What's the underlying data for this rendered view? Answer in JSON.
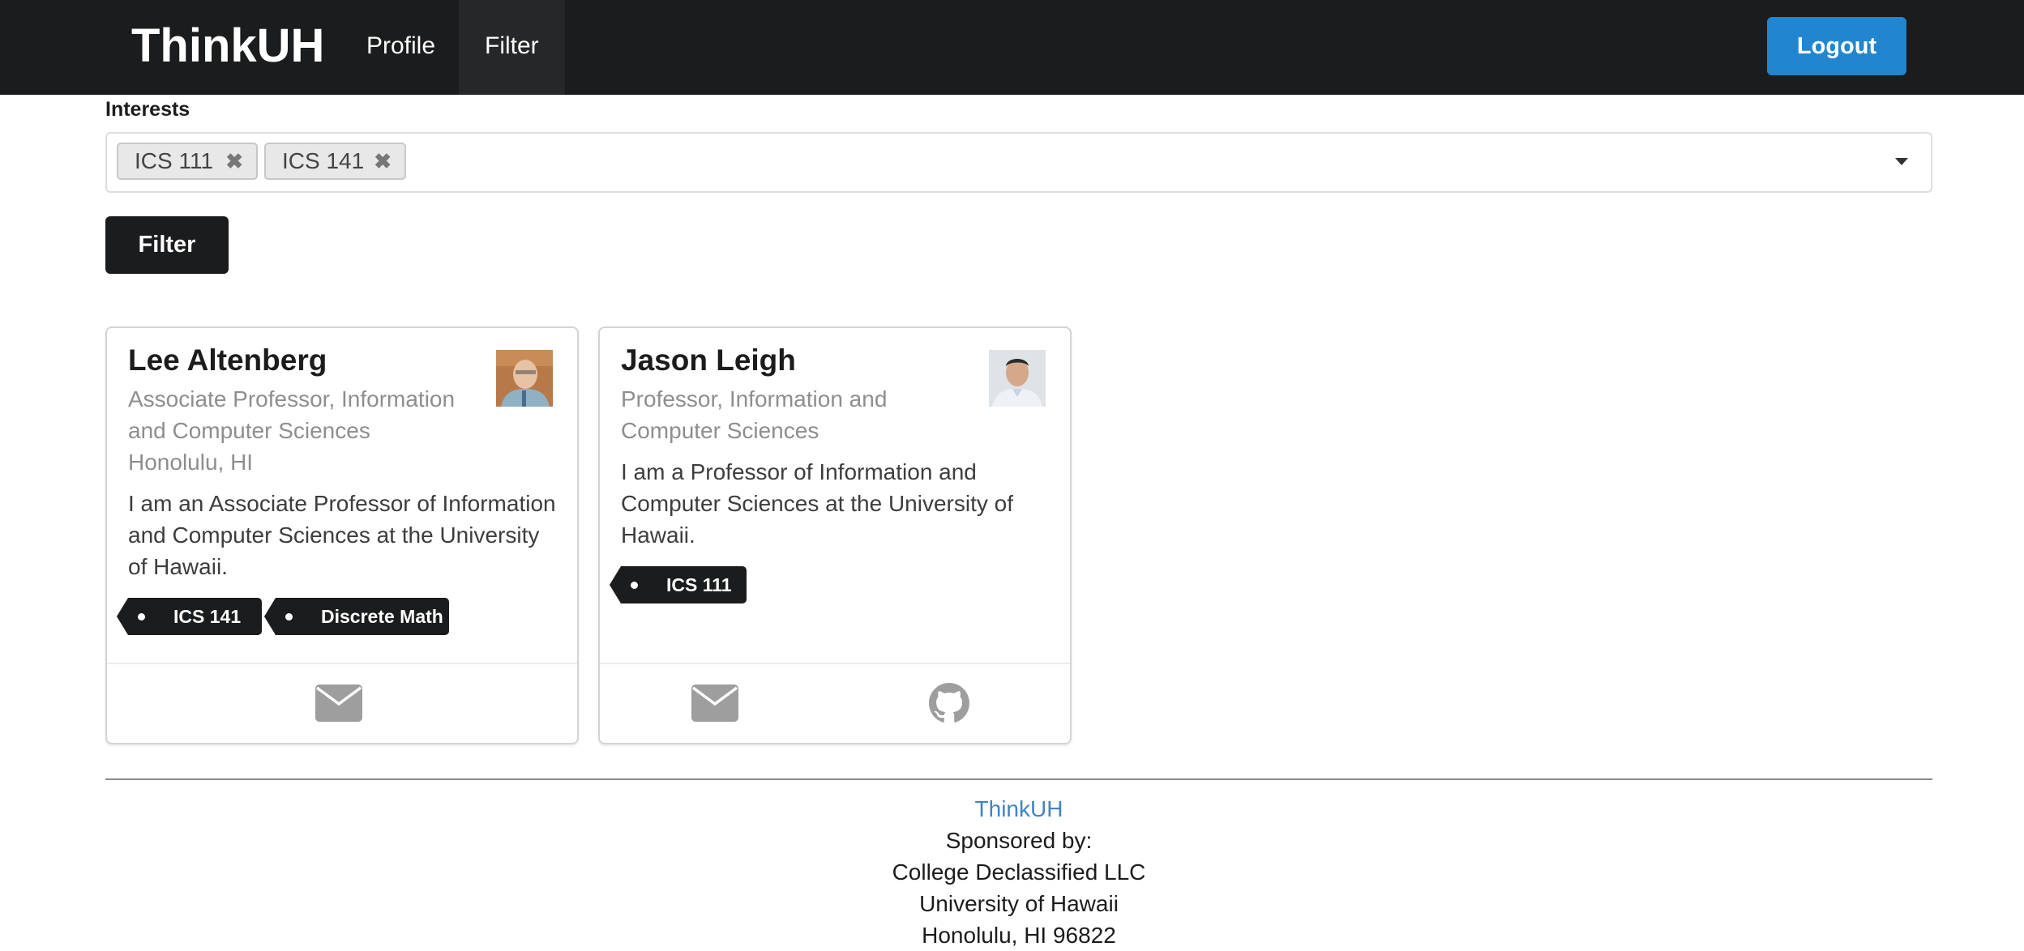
{
  "nav": {
    "brand": "ThinkUH",
    "items": [
      {
        "label": "Profile"
      },
      {
        "label": "Filter"
      }
    ],
    "logout_label": "Logout"
  },
  "filter_form": {
    "interests_label": "Interests",
    "selected": [
      {
        "label": "ICS 111"
      },
      {
        "label": "ICS 141"
      }
    ],
    "submit_label": "Filter"
  },
  "profiles": [
    {
      "name": "Lee Altenberg",
      "title_line1": "Associate Professor, Information",
      "title_line2": "and Computer Sciences",
      "location": "Honolulu, HI",
      "bio_line1": "I am an Associate Professor of Information",
      "bio_line2": "and Computer Sciences at the University",
      "bio_line3": "of Hawaii.",
      "interests": [
        "ICS 141",
        "Discrete Math"
      ],
      "contact_icons": [
        "envelope-icon"
      ]
    },
    {
      "name": "Jason Leigh",
      "title_line1": "Professor, Information and",
      "title_line2": "Computer Sciences",
      "location": "",
      "bio_line1": "I am a Professor of Information and",
      "bio_line2": "Computer Sciences at the University of",
      "bio_line3": "Hawaii.",
      "interests": [
        "ICS 111"
      ],
      "contact_icons": [
        "envelope-icon",
        "github-icon"
      ]
    }
  ],
  "footer": {
    "link": "ThinkUH",
    "line1": "Sponsored by:",
    "line2": "College Declassified LLC",
    "line3": "University of Hawaii",
    "line4": "Honolulu, HI 96822"
  },
  "colors": {
    "navbar": "#1b1c1d",
    "primary_button": "#2185d0",
    "link": "#4183c4",
    "icon_gray": "#9e9e9e"
  }
}
